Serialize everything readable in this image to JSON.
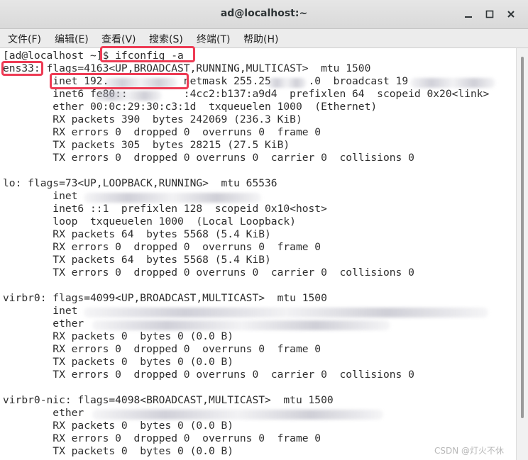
{
  "window": {
    "title": "ad@localhost:~",
    "controls": [
      "minimize-icon",
      "maximize-icon",
      "close-icon"
    ]
  },
  "menu": [
    "文件(F)",
    "编辑(E)",
    "查看(V)",
    "搜索(S)",
    "终端(T)",
    "帮助(H)"
  ],
  "terminal": {
    "lines": [
      "[ad@localhost ~]$ ifconfig -a",
      "ens33: flags=4163<UP,BROADCAST,RUNNING,MULTICAST>  mtu 1500",
      "        inet 192.            netmask 255.25      .0  broadcast 19",
      "        inet6 fe80::         :4cc2:b137:a9d4  prefixlen 64  scopeid 0x20<link>",
      "        ether 00:0c:29:30:c3:1d  txqueuelen 1000  (Ethernet)",
      "        RX packets 390  bytes 242069 (236.3 KiB)",
      "        RX errors 0  dropped 0  overruns 0  frame 0",
      "        TX packets 305  bytes 28215 (27.5 KiB)",
      "        TX errors 0  dropped 0 overruns 0  carrier 0  collisions 0",
      "",
      "lo: flags=73<UP,LOOPBACK,RUNNING>  mtu 65536",
      "        inet",
      "        inet6 ::1  prefixlen 128  scopeid 0x10<host>",
      "        loop  txqueuelen 1000  (Local Loopback)",
      "        RX packets 64  bytes 5568 (5.4 KiB)",
      "        RX errors 0  dropped 0  overruns 0  frame 0",
      "        TX packets 64  bytes 5568 (5.4 KiB)",
      "        TX errors 0  dropped 0 overruns 0  carrier 0  collisions 0",
      "",
      "virbr0: flags=4099<UP,BROADCAST,MULTICAST>  mtu 1500",
      "        inet",
      "        ether",
      "        RX packets 0  bytes 0 (0.0 B)",
      "        RX errors 0  dropped 0  overruns 0  frame 0",
      "        TX packets 0  bytes 0 (0.0 B)",
      "        TX errors 0  dropped 0 overruns 0  carrier 0  collisions 0",
      "",
      "virbr0-nic: flags=4098<BROADCAST,MULTICAST>  mtu 1500",
      "        ether",
      "        RX packets 0  bytes 0 (0.0 B)",
      "        RX errors 0  dropped 0  overruns 0  frame 0",
      "        TX packets 0  bytes 0 (0.0 B)"
    ]
  },
  "watermark": "CSDN @灯火不休",
  "colors": {
    "highlight": "#ee3b54",
    "terminal_bg": "#ffffff",
    "terminal_fg": "#2e2e2e"
  }
}
